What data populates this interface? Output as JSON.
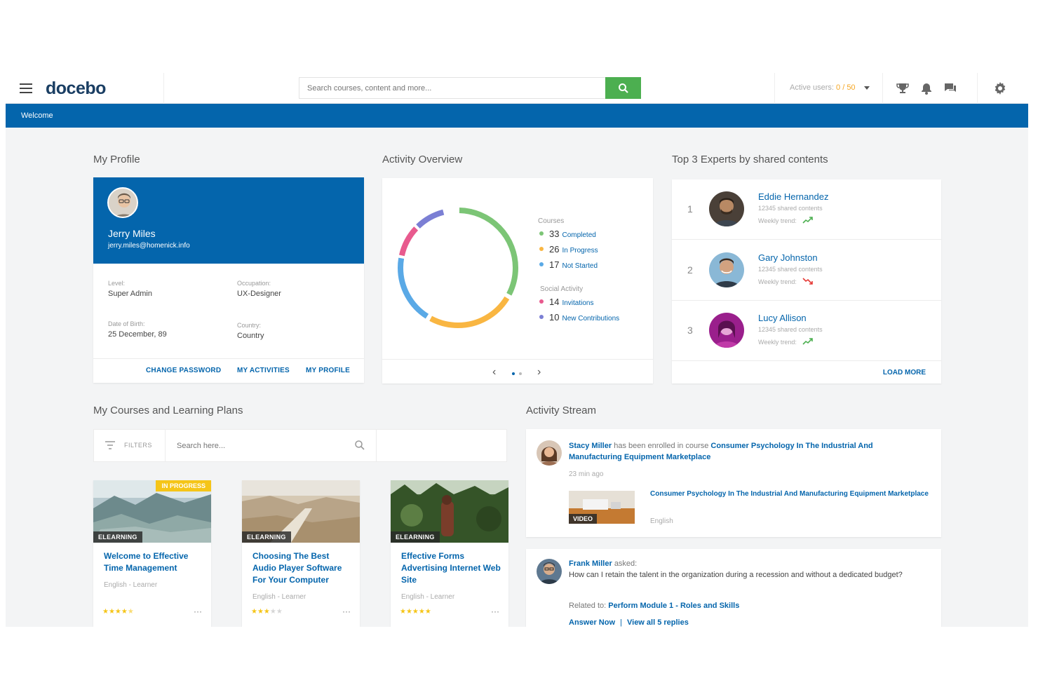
{
  "header": {
    "logo": "docebo",
    "search_placeholder": "Search courses, content and more...",
    "active_users_label": "Active users:",
    "active_users_value": "0 / 50"
  },
  "bluebar": {
    "welcome": "Welcome"
  },
  "sections": {
    "profile": "My Profile",
    "activity": "Activity Overview",
    "experts": "Top 3 Experts by shared contents",
    "courses": "My Courses and Learning Plans",
    "stream": "Activity Stream"
  },
  "profile": {
    "name": "Jerry Miles",
    "email": "jerry.miles@homenick.info",
    "level_label": "Level:",
    "level": "Super Admin",
    "occupation_label": "Occupation:",
    "occupation": "UX-Designer",
    "dob_label": "Date of Birth:",
    "dob": "25 December, 89",
    "country_label": "Country:",
    "country": "Country",
    "links": [
      "CHANGE PASSWORD",
      "MY ACTIVITIES",
      "MY PROFILE"
    ]
  },
  "activity": {
    "courses_label": "Courses",
    "social_label": "Social Activity",
    "courses": [
      {
        "n": "33",
        "label": "Completed",
        "color": "#7cc576"
      },
      {
        "n": "26",
        "label": "In Progress",
        "color": "#f9b642"
      },
      {
        "n": "17",
        "label": "Not Started",
        "color": "#5aa9e6"
      }
    ],
    "social": [
      {
        "n": "14",
        "label": "Invitations",
        "color": "#e85a8e"
      },
      {
        "n": "10",
        "label": "New Contributions",
        "color": "#7b7fd4"
      }
    ],
    "pager": {
      "pages": 2,
      "current": 1
    }
  },
  "experts": {
    "items": [
      {
        "rank": "1",
        "name": "Eddie Hernandez",
        "shared": "12345 shared contents",
        "trend_label": "Weekly trend:",
        "trend": "up"
      },
      {
        "rank": "2",
        "name": "Gary Johnston",
        "shared": "12345 shared contents",
        "trend_label": "Weekly trend:",
        "trend": "down"
      },
      {
        "rank": "3",
        "name": "Lucy Allison",
        "shared": "12345 shared contents",
        "trend_label": "Weekly trend:",
        "trend": "up"
      }
    ],
    "load_more": "LOAD MORE"
  },
  "courses": {
    "filters_label": "FILTERS",
    "search_placeholder": "Search here...",
    "items": [
      {
        "type": "ELEARNING",
        "badge": "IN PROGRESS",
        "title": "Welcome to Effective Time Management",
        "meta": "English - Learner",
        "rating": 4.5,
        "more": "···"
      },
      {
        "type": "ELEARNING",
        "badge": "",
        "title": "Choosing The Best Audio Player Software For Your Computer",
        "meta": "English - Learner",
        "rating": 3,
        "more": "···"
      },
      {
        "type": "ELEARNING",
        "badge": "",
        "title": "Effective Forms Advertising Internet Web Site",
        "meta": "English - Learner",
        "rating": 5,
        "more": "···"
      }
    ]
  },
  "stream": {
    "item1": {
      "user": "Stacy Miller",
      "action": "has been enrolled in course",
      "course": "Consumer Psychology In The Industrial And Manufacturing Equipment Marketplace",
      "time": "23 min ago",
      "video_badge": "VIDEO",
      "attachment_title": "Consumer Psychology In The Industrial And Manufacturing Equipment Marketplace",
      "attachment_lang": "English"
    },
    "item2": {
      "user": "Frank Miller",
      "action": "asked:",
      "question": "How can I retain the talent in the organization during a recession and without a dedicated budget?",
      "related_label": "Related to:",
      "related": "Perform Module 1 - Roles and Skills",
      "answer": "Answer Now",
      "sep": "|",
      "replies": "View all 5 replies"
    }
  }
}
